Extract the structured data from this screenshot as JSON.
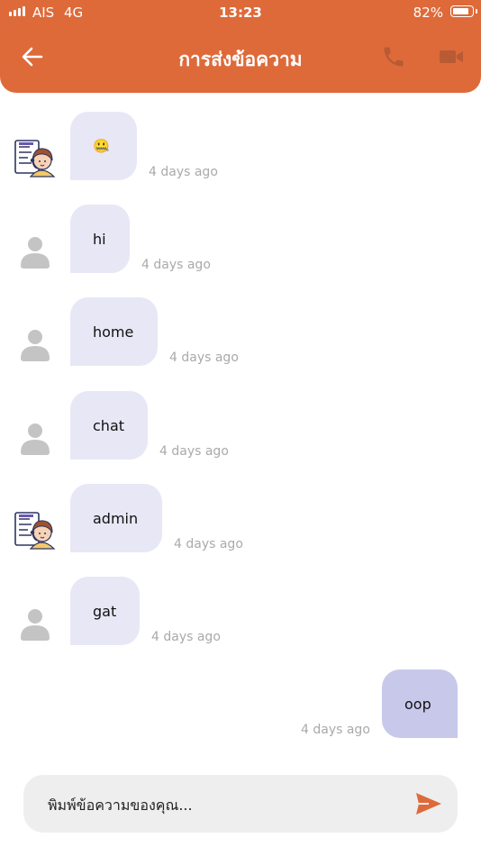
{
  "status_bar": {
    "carrier": "AIS",
    "network": "4G",
    "time": "13:23",
    "battery": "82%"
  },
  "header": {
    "title": "การส่งข้อความ",
    "back_icon": "arrow-left-icon",
    "call_icon": "phone-icon",
    "video_icon": "video-camera-icon",
    "color": "#de6a3a"
  },
  "messages": [
    {
      "sender": "admin",
      "avatar": "support-agent-avatar",
      "text": "🤐",
      "time": "4 days ago"
    },
    {
      "sender": "user",
      "avatar": "default-person-avatar",
      "text": "hi",
      "time": "4 days ago"
    },
    {
      "sender": "user",
      "avatar": "default-person-avatar",
      "text": "home",
      "time": "4 days ago"
    },
    {
      "sender": "user",
      "avatar": "default-person-avatar",
      "text": "chat",
      "time": "4 days ago"
    },
    {
      "sender": "admin",
      "avatar": "support-agent-avatar",
      "text": "admin",
      "time": "4 days ago"
    },
    {
      "sender": "user",
      "avatar": "default-person-avatar",
      "text": "gat",
      "time": "4 days ago"
    },
    {
      "sender": "me",
      "text": "oop",
      "time": "4 days ago"
    }
  ],
  "composer": {
    "placeholder": "พิมพ์ข้อความของคุณ...",
    "send_icon": "send-icon"
  },
  "colors": {
    "incoming_bubble": "#e8e7f5",
    "outgoing_bubble": "#c7c8ea",
    "timestamp": "#aaaaaa"
  }
}
